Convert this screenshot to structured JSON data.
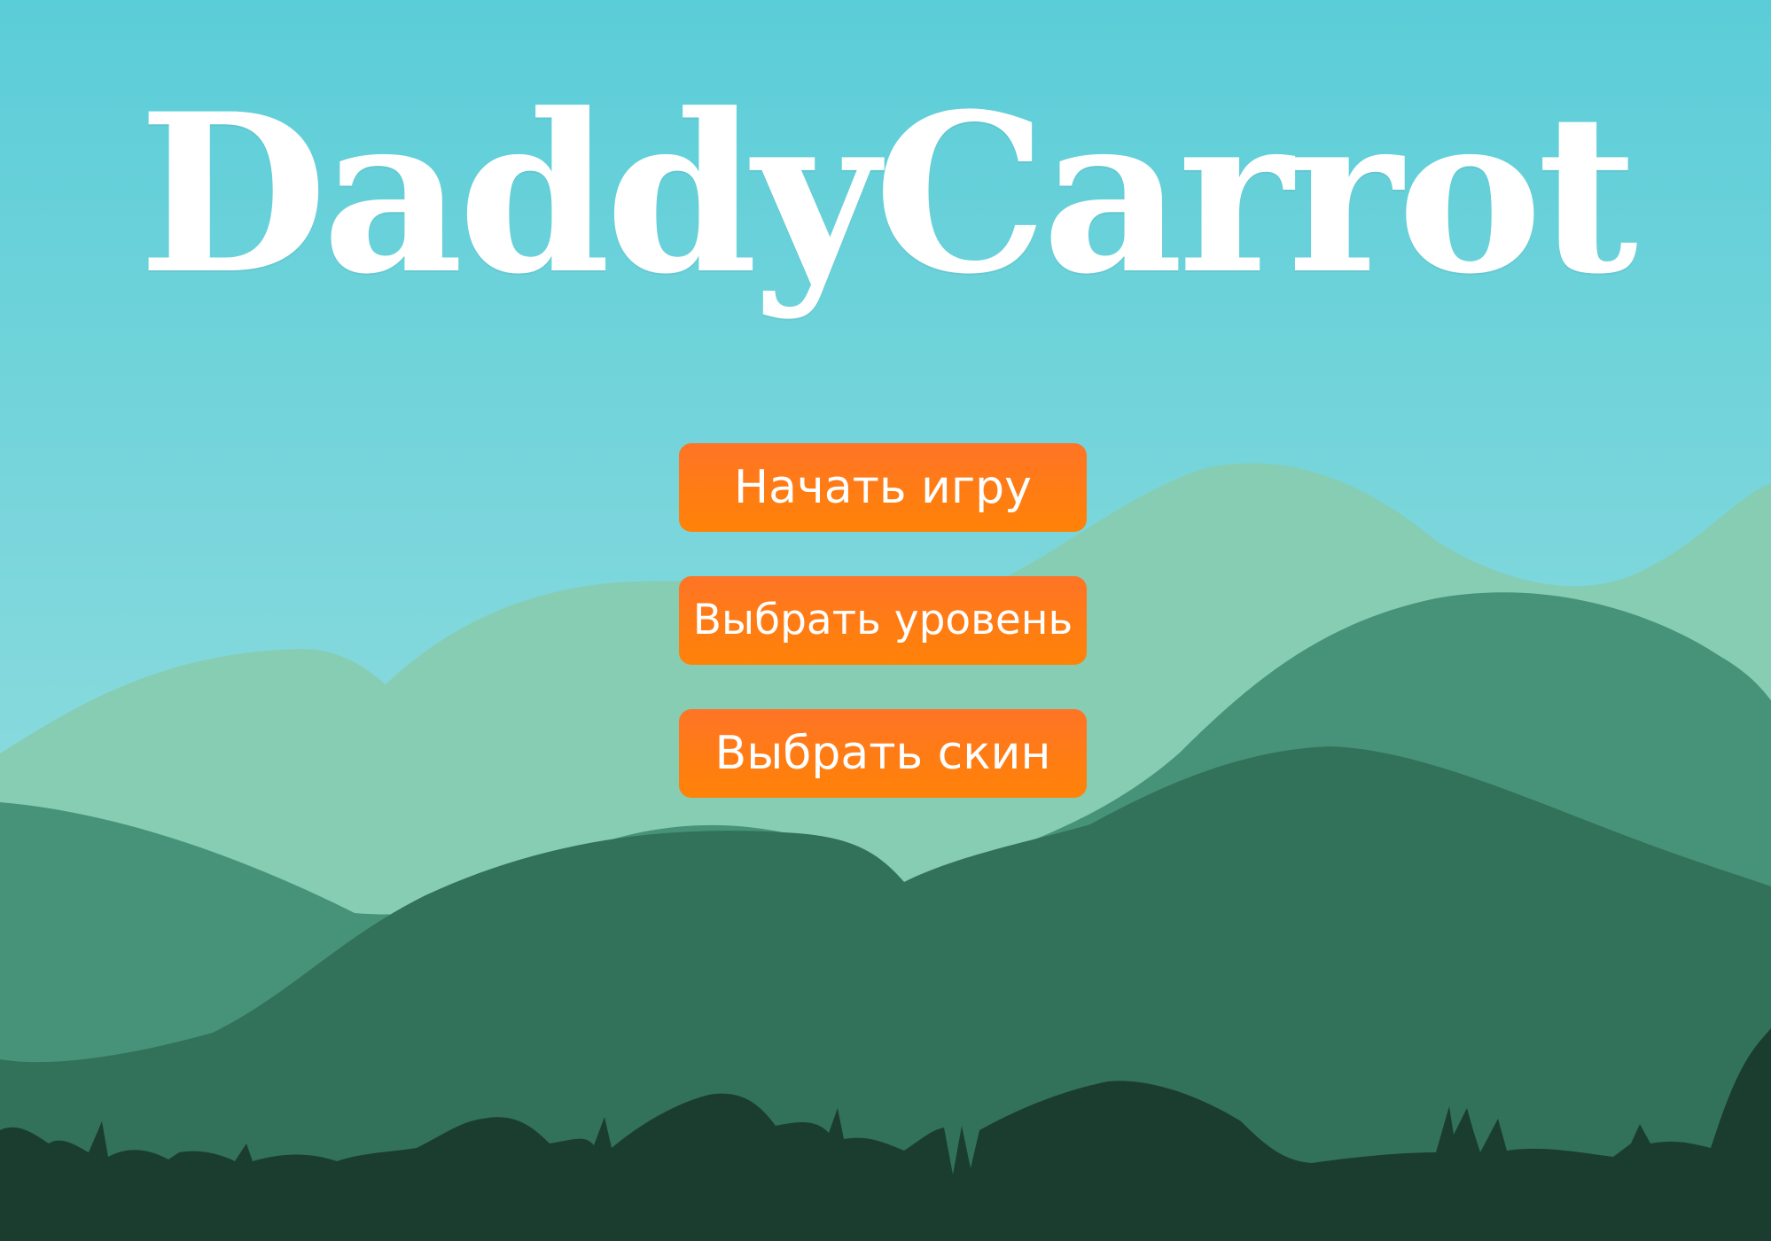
{
  "game": {
    "title": "DaddyCarrot"
  },
  "menu": {
    "buttons": [
      {
        "label": "Начать игру",
        "action": "start-game"
      },
      {
        "label": "Выбрать уровень",
        "action": "select-level"
      },
      {
        "label": "Выбрать скин",
        "action": "select-skin"
      }
    ]
  },
  "colors": {
    "sky_top": "#5bcdd8",
    "sky_bottom": "#9fe0df",
    "hill_far": "#87cdb4",
    "hill_mid": "#479379",
    "hill_near": "#32725a",
    "foreground": "#1b3d30",
    "button_orange": "#ff7d12",
    "title_text": "#ffffff"
  }
}
